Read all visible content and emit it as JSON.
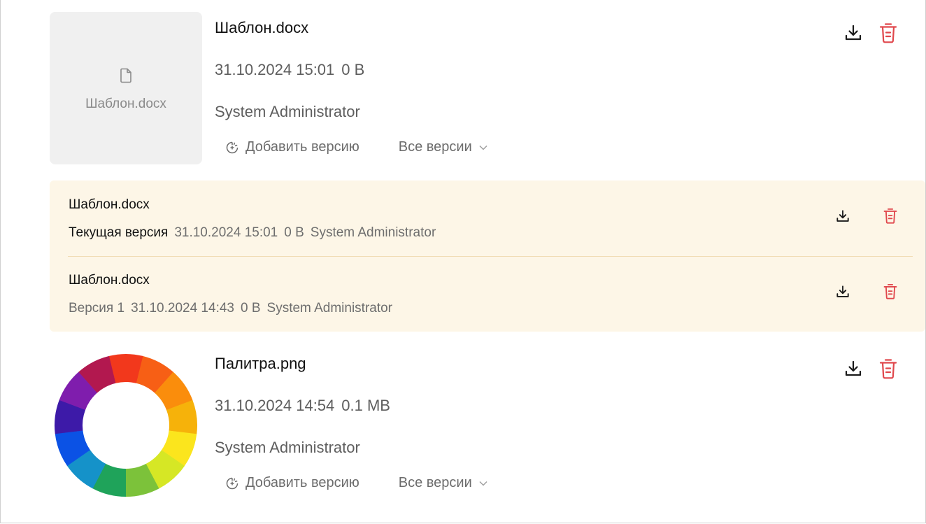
{
  "files": [
    {
      "name": "Шаблон.docx",
      "date": "31.10.2024 15:01",
      "size": "0 B",
      "author": "System Administrator",
      "thumb_label": "Шаблон.docx",
      "thumb_icon": "document-icon",
      "add_version_label": "Добавить версию",
      "all_versions_label": "Все версии"
    },
    {
      "name": "Палитра.png",
      "date": "31.10.2024 14:54",
      "size": "0.1 MB",
      "author": "System Administrator",
      "thumb_icon": "color-wheel-image",
      "add_version_label": "Добавить версию",
      "all_versions_label": "Все версии"
    }
  ],
  "versions": [
    {
      "name": "Шаблон.docx",
      "label": "Текущая версия",
      "date": "31.10.2024 15:01",
      "size": "0 B",
      "author": "System Administrator"
    },
    {
      "name": "Шаблон.docx",
      "label": "Версия 1",
      "date": "31.10.2024 14:43",
      "size": "0 B",
      "author": "System Administrator"
    }
  ],
  "colors": {
    "delete_icon": "#e0474c",
    "versions_panel_bg": "#fdf6e7",
    "thumb_bg": "#f0f0f0"
  },
  "icons": {
    "download": "download-icon",
    "delete": "trash-icon",
    "add_version": "add-version-icon",
    "chevron": "chevron-down-icon"
  }
}
